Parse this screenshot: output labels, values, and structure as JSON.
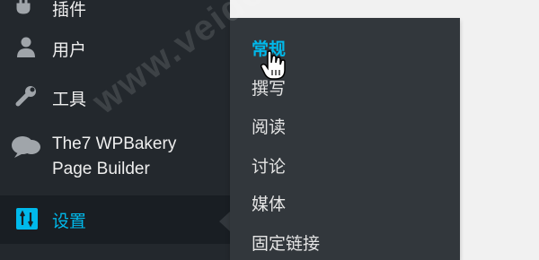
{
  "sidebar": {
    "items": [
      {
        "label": "插件",
        "icon": "plugin-icon"
      },
      {
        "label": "用户",
        "icon": "user-icon"
      },
      {
        "label": "工具",
        "icon": "wrench-icon"
      },
      {
        "label_line1": "The7 WPBakery",
        "label_line2": "Page Builder",
        "icon": "speech-bubble-icon"
      },
      {
        "label": "设置",
        "icon": "settings-icon",
        "active": true
      }
    ]
  },
  "submenu": {
    "items": [
      {
        "label": "常规",
        "current": true
      },
      {
        "label": "撰写"
      },
      {
        "label": "阅读"
      },
      {
        "label": "讨论"
      },
      {
        "label": "媒体"
      },
      {
        "label": "固定链接"
      }
    ]
  },
  "colors": {
    "sidebar_bg": "#23282d",
    "active_bg": "#191e23",
    "flyout_bg": "#32373c",
    "accent": "#00b9eb",
    "text": "#eeeeee"
  },
  "watermark": "www.veide"
}
